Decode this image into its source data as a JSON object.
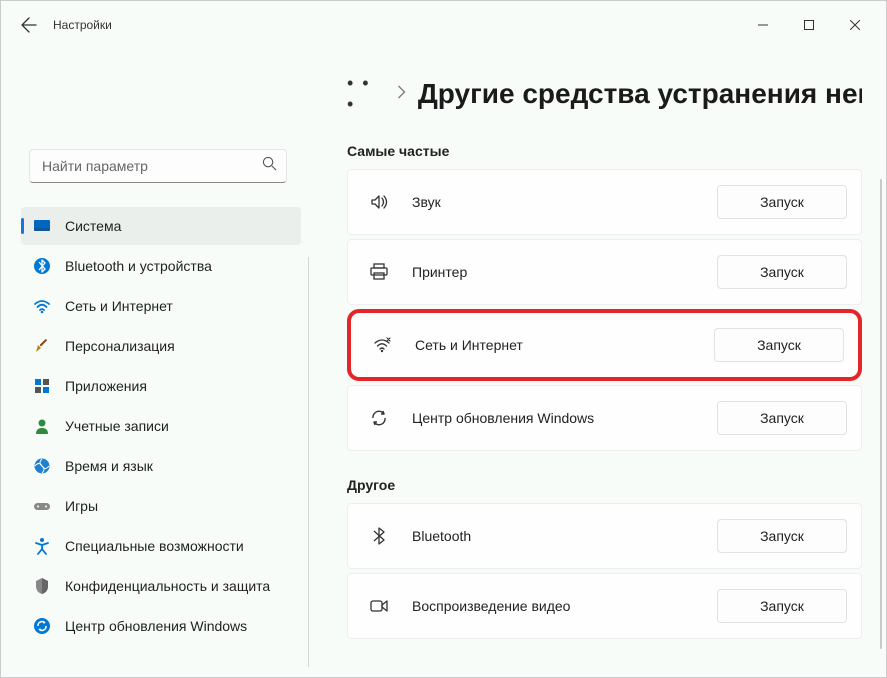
{
  "app_title": "Настройки",
  "search": {
    "placeholder": "Найти параметр"
  },
  "sidebar": {
    "items": [
      {
        "id": "system",
        "label": "Система",
        "active": true
      },
      {
        "id": "bluetooth",
        "label": "Bluetooth и устройства"
      },
      {
        "id": "network",
        "label": "Сеть и Интернет"
      },
      {
        "id": "personalization",
        "label": "Персонализация"
      },
      {
        "id": "apps",
        "label": "Приложения"
      },
      {
        "id": "accounts",
        "label": "Учетные записи"
      },
      {
        "id": "time",
        "label": "Время и язык"
      },
      {
        "id": "gaming",
        "label": "Игры"
      },
      {
        "id": "accessibility",
        "label": "Специальные возможности"
      },
      {
        "id": "privacy",
        "label": "Конфиденциальность и защита"
      },
      {
        "id": "update",
        "label": "Центр обновления Windows"
      }
    ]
  },
  "breadcrumb": {
    "dots": "• • •",
    "title": "Другие средства устранения неп"
  },
  "content": {
    "launch_label": "Запуск",
    "section_frequent": "Самые частые",
    "section_other": "Другое",
    "frequent": [
      {
        "id": "sound",
        "label": "Звук"
      },
      {
        "id": "printer",
        "label": "Принтер"
      },
      {
        "id": "internet",
        "label": "Сеть и Интернет",
        "highlight": true
      },
      {
        "id": "winupdate",
        "label": "Центр обновления Windows"
      }
    ],
    "other": [
      {
        "id": "bt",
        "label": "Bluetooth"
      },
      {
        "id": "video",
        "label": "Воспроизведение видео"
      }
    ]
  }
}
